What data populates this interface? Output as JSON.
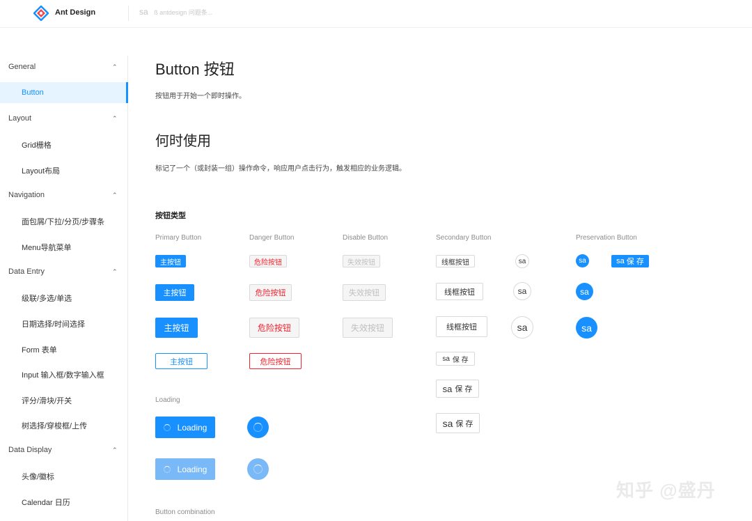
{
  "header": {
    "brand": "Ant Design",
    "search_tag": "sa",
    "search_hint": "ß  antdesign 问题条..."
  },
  "sidebar": {
    "groups": [
      {
        "label": "General",
        "items": [
          "Button"
        ]
      },
      {
        "label": "Layout",
        "items": [
          "Grid栅格",
          "Layout布局"
        ]
      },
      {
        "label": "Navigation",
        "items": [
          "面包屑/下拉/分页/步骤条",
          "Menu导航菜单"
        ]
      },
      {
        "label": "Data Entry",
        "items": [
          "级联/多选/单选",
          "日期选择/时间选择",
          "Form 表单",
          "Input 输入框/数字输入框",
          "评分/滑块/开关",
          "树选择/穿梭框/上传"
        ]
      },
      {
        "label": "Data Display",
        "items": [
          "头像/徽标",
          "Calendar 日历"
        ]
      }
    ],
    "active": "Button"
  },
  "main": {
    "title": "Button  按钮",
    "intro": "按钮用于开始一个即时操作。",
    "when_title": "何时使用",
    "when_text": "标记了一个（或封装一组）操作命令，响应用户点击行为，触发相应的业务逻辑。",
    "types_title": "按钮类型",
    "columns": [
      "Primary Button",
      "Danger Button",
      "Disable Button",
      "Secondary Button",
      "Preservation Button"
    ],
    "primary_label": "主按钮",
    "danger_label": "危险按钮",
    "disabled_label": "失效按钮",
    "secondary_label": "线框按钮",
    "sa_label": "sa",
    "save_label": "保 存",
    "loading_title": "Loading",
    "loading_label": "Loading",
    "combination_title": "Button combination"
  },
  "colors": {
    "primary": "#1890ff",
    "danger": "#f5222d",
    "disabled": "#bfbfbf"
  },
  "watermark": "知乎 @盛丹"
}
